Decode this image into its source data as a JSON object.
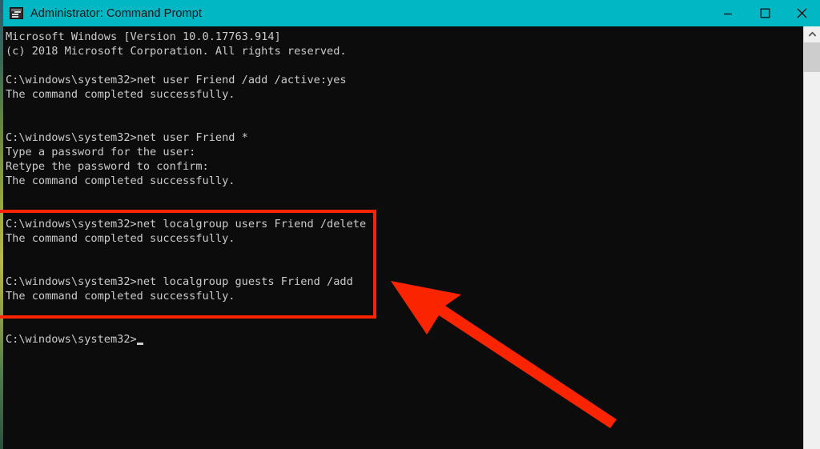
{
  "window": {
    "title": "Administrator: Command Prompt",
    "icon": "console-icon",
    "titlebar_color": "#00b7c3",
    "background_color": "#0c0c0c",
    "foreground_color": "#cccccc",
    "controls": {
      "minimize_label": "Minimize",
      "maximize_label": "Maximize",
      "close_label": "Close"
    }
  },
  "console": {
    "prompt": "C:\\windows\\system32>",
    "cursor": "_",
    "text": "Microsoft Windows [Version 10.0.17763.914]\n(c) 2018 Microsoft Corporation. All rights reserved.\n\nC:\\windows\\system32>net user Friend /add /active:yes\nThe command completed successfully.\n\n\nC:\\windows\\system32>net user Friend *\nType a password for the user:\nRetype the password to confirm:\nThe command completed successfully.\n\n\nC:\\windows\\system32>net localgroup users Friend /delete\nThe command completed successfully.\n\n\nC:\\windows\\system32>net localgroup guests Friend /add\nThe command completed successfully.\n\n\nC:\\windows\\system32>",
    "lines": [
      "Microsoft Windows [Version 10.0.17763.914]",
      "(c) 2018 Microsoft Corporation. All rights reserved.",
      "",
      "C:\\windows\\system32>net user Friend /add /active:yes",
      "The command completed successfully.",
      "",
      "",
      "C:\\windows\\system32>net user Friend *",
      "Type a password for the user:",
      "Retype the password to confirm:",
      "The command completed successfully.",
      "",
      "",
      "C:\\windows\\system32>net localgroup users Friend /delete",
      "The command completed successfully.",
      "",
      "",
      "C:\\windows\\system32>net localgroup guests Friend /add",
      "The command completed successfully.",
      "",
      "",
      "C:\\windows\\system32>"
    ],
    "commands": [
      "net user Friend /add /active:yes",
      "net user Friend *",
      "net localgroup users Friend /delete",
      "net localgroup guests Friend /add"
    ]
  },
  "scrollbar": {
    "up_arrow": "scroll-up-arrow",
    "thumb": "scroll-thumb"
  },
  "annotations": {
    "highlight_color": "#fb2400",
    "arrow_color": "#fb2400",
    "highlight_description": "red rectangle around the two localgroup commands",
    "arrow_description": "red arrow pointing up-left at the highlighted commands"
  }
}
